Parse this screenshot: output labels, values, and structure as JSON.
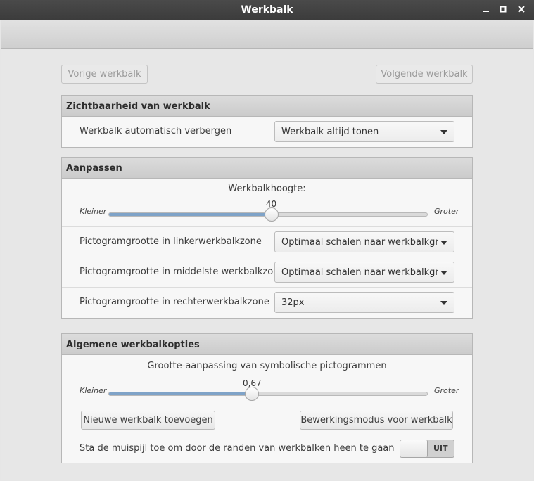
{
  "window": {
    "title": "Werkbalk"
  },
  "nav": {
    "previous_label": "Vorige werkbalk",
    "next_label": "Volgende werkbalk"
  },
  "visibility": {
    "header": "Zichtbaarheid van werkbalk",
    "autohide_label": "Werkbalk automatisch verbergen",
    "autohide_value": "Werkbalk altijd tonen"
  },
  "customize": {
    "header": "Aanpassen",
    "height": {
      "caption": "Werkbalkhoogte:",
      "min_label": "Kleiner",
      "max_label": "Groter",
      "value": "40",
      "fraction": 0.51
    },
    "left_zone_label": "Pictogramgrootte in linkerwerkbalkzone",
    "left_zone_value": "Optimaal schalen naar werkbalkgrootte",
    "middle_zone_label": "Pictogramgrootte in middelste werkbalkzone",
    "middle_zone_value": "Optimaal schalen naar werkbalkgrootte",
    "right_zone_label": "Pictogramgrootte in rechterwerkbalkzone",
    "right_zone_value": "32px"
  },
  "general": {
    "header": "Algemene werkbalkopties",
    "symbolic": {
      "caption": "Grootte-aanpassing van symbolische pictogrammen",
      "min_label": "Kleiner",
      "max_label": "Groter",
      "value": "0,67",
      "fraction": 0.45
    },
    "add_button": "Nieuwe werkbalk toevoegen",
    "edit_mode_button": "Bewerkingsmodus voor werkbalk",
    "pointer_label": "Sta de muispijl toe om door de randen van werkbalken heen te gaan",
    "pointer_toggle": "UIT"
  },
  "colors": {
    "titlebar": "#3f3f3f",
    "slider_fill": "#7fa3c8",
    "section_header": "#d3d3d3"
  },
  "icons": {
    "minimize": "minimize-icon",
    "maximize": "maximize-icon",
    "close": "close-icon",
    "dropdown": "chevron-down-icon"
  }
}
